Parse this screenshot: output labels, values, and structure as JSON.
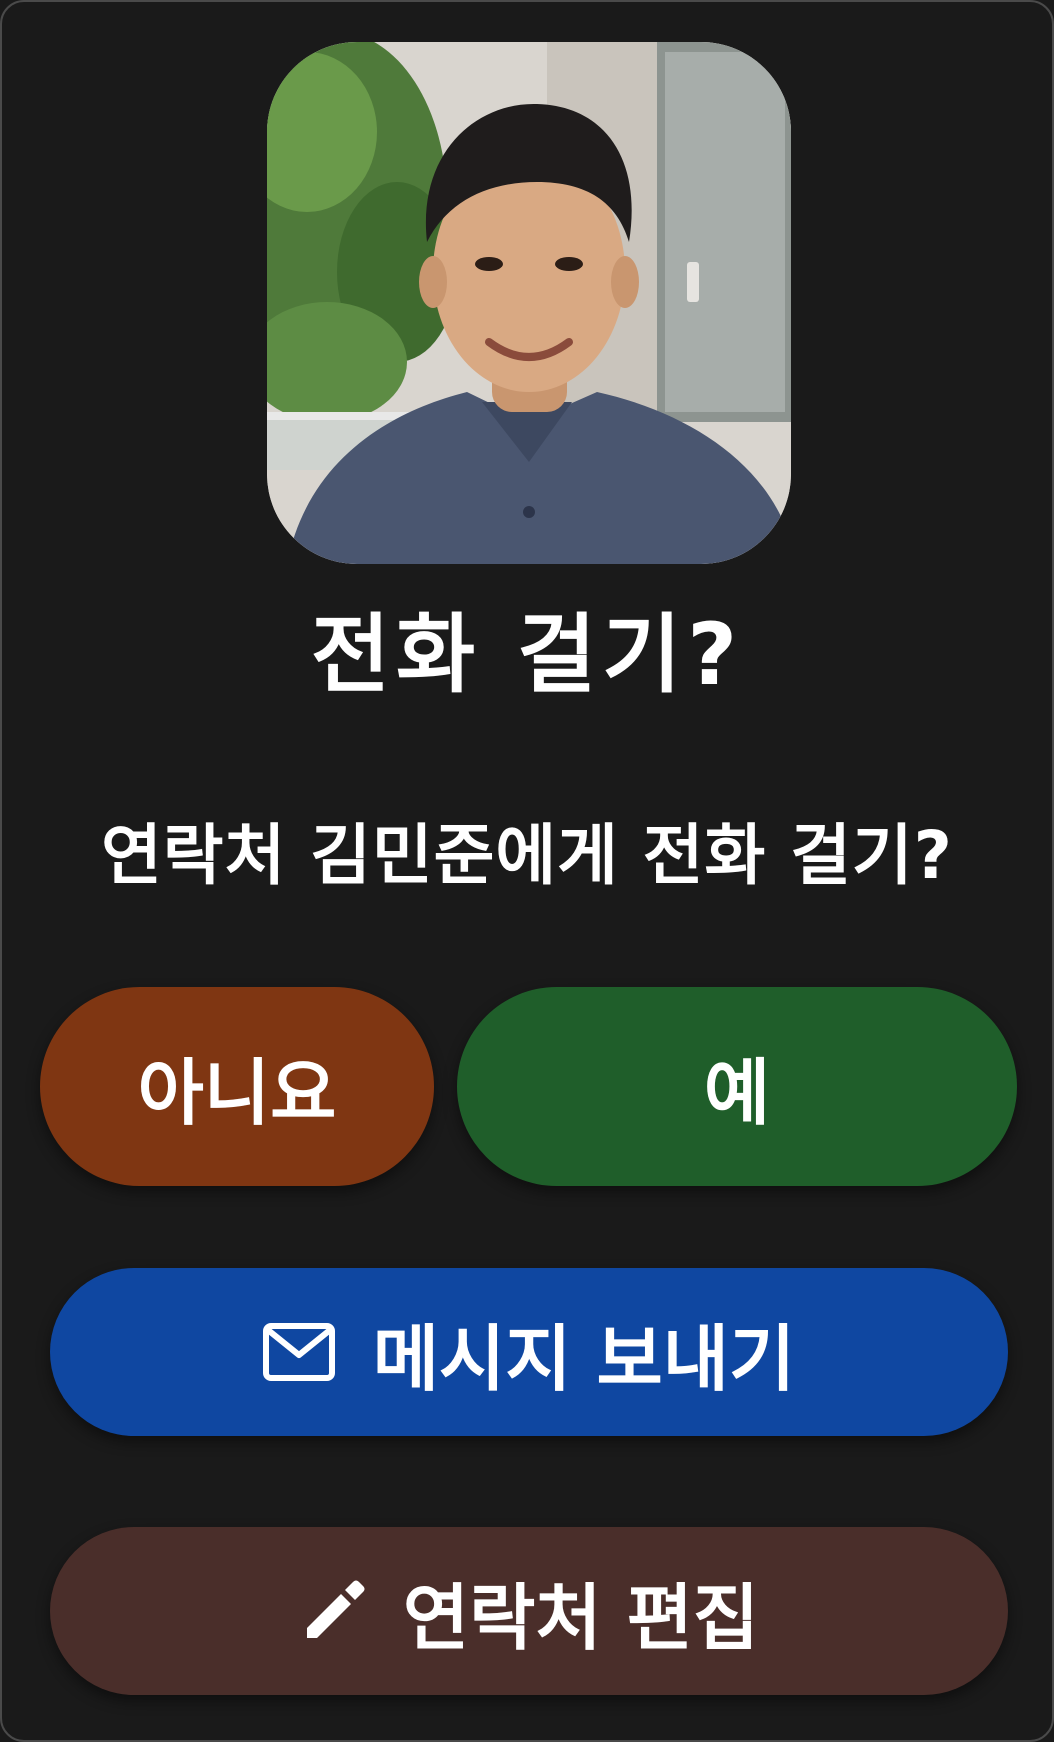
{
  "dialog": {
    "title": "전화 걸기?",
    "message": "연락처 김민준에게 전화 걸기?"
  },
  "buttons": {
    "no_label": "아니요",
    "yes_label": "예",
    "message_label": "메시지 보내기",
    "edit_label": "연락처 편집"
  },
  "icons": {
    "message": "mail-icon",
    "edit": "pencil-icon"
  },
  "colors": {
    "background": "#1a1a1a",
    "no_button": "#7f3612",
    "yes_button": "#1f5e2a",
    "message_button": "#0f47a1",
    "edit_button": "#4a2e2a"
  }
}
